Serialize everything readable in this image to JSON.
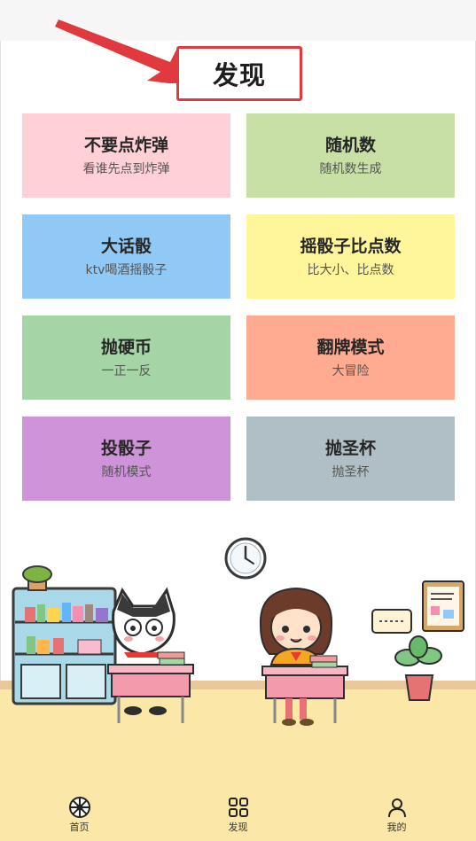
{
  "header": {
    "title": "发现"
  },
  "cards": [
    {
      "title": "不要点炸弹",
      "subtitle": "看谁先点到炸弹",
      "color": "#ffd0d5"
    },
    {
      "title": "随机数",
      "subtitle": "随机数生成",
      "color": "#c8e0a5"
    },
    {
      "title": "大话骰",
      "subtitle": "ktv喝酒摇骰子",
      "color": "#90c9f6"
    },
    {
      "title": "摇骰子比点数",
      "subtitle": "比大小、比点数",
      "color": "#fff59b"
    },
    {
      "title": "抛硬币",
      "subtitle": "一正一反",
      "color": "#a5d5a6"
    },
    {
      "title": "翻牌模式",
      "subtitle": "大冒险",
      "color": "#ffab91"
    },
    {
      "title": "投骰子",
      "subtitle": "随机模式",
      "color": "#ce93d9"
    },
    {
      "title": "抛圣杯",
      "subtitle": "抛圣杯",
      "color": "#b0bec5"
    }
  ],
  "tabbar": {
    "items": [
      {
        "label": "首页",
        "icon": "aperture-icon"
      },
      {
        "label": "发现",
        "icon": "grid-icon"
      },
      {
        "label": "我的",
        "icon": "user-icon"
      }
    ]
  },
  "colors": {
    "accent_red": "#e0393e",
    "floor": "#fbe8a8"
  }
}
